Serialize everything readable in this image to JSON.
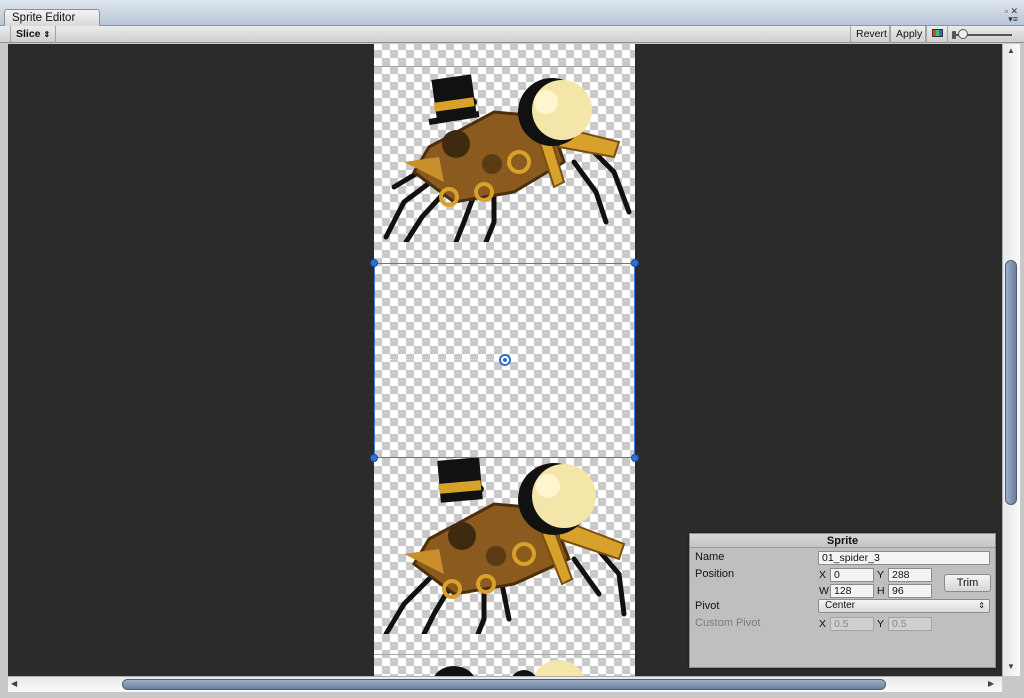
{
  "window": {
    "tab_title": "Sprite Editor",
    "controls_icon": "window-controls-icon"
  },
  "toolbar": {
    "slice_label": "Slice",
    "slice_arrow": "⇕",
    "revert_label": "Revert",
    "apply_label": "Apply",
    "color_toggle_icon": "rgb-channels-icon",
    "zoom_icon": "zoom-slider-icon"
  },
  "sprite_panel": {
    "title": "Sprite",
    "name_label": "Name",
    "name_value": "01_spider_3",
    "position_label": "Position",
    "x_label": "X",
    "x_value": "0",
    "y_label": "Y",
    "y_value": "288",
    "w_label": "W",
    "w_value": "128",
    "h_label": "H",
    "h_value": "96",
    "trim_label": "Trim",
    "pivot_label": "Pivot",
    "pivot_value": "Center",
    "custom_pivot_label": "Custom Pivot",
    "custom_x_label": "X",
    "custom_x_value": "0.5",
    "custom_y_label": "Y",
    "custom_y_value": "0.5"
  },
  "colors": {
    "canvas_bg": "#2b2b2b",
    "selection": "#3a7fd8",
    "spider_brown": "#8a5a1f",
    "spider_gold": "#d8a12c",
    "spider_head": "#f4e6a8",
    "hat": "#111111"
  }
}
